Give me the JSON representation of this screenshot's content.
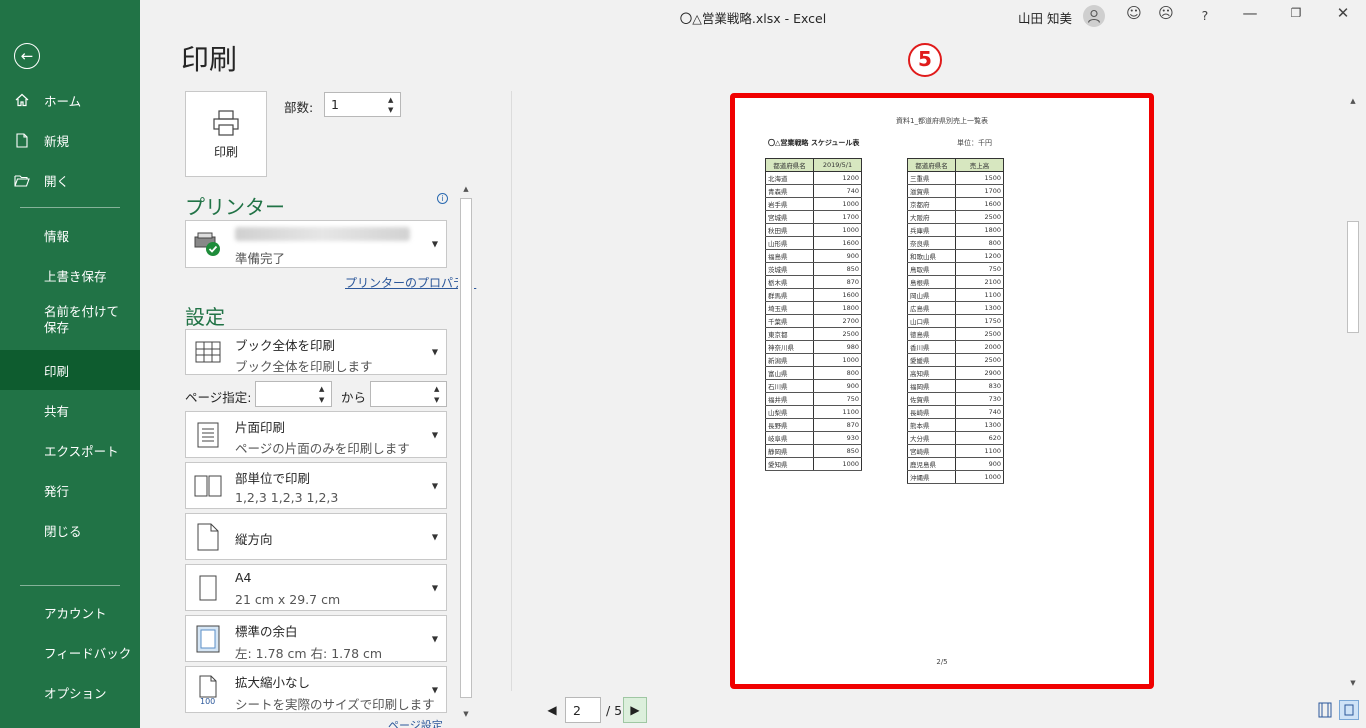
{
  "window": {
    "title": "〇△営業戦略.xlsx  -  Excel",
    "user": "山田 知美",
    "help": "?"
  },
  "sidebar": {
    "items": [
      {
        "label": "ホーム"
      },
      {
        "label": "新規"
      },
      {
        "label": "開く"
      },
      {
        "label": "情報"
      },
      {
        "label": "上書き保存"
      },
      {
        "label": "名前を付けて保存"
      },
      {
        "label": "印刷"
      },
      {
        "label": "共有"
      },
      {
        "label": "エクスポート"
      },
      {
        "label": "発行"
      },
      {
        "label": "閉じる"
      },
      {
        "label": "アカウント"
      },
      {
        "label": "フィードバック"
      },
      {
        "label": "オプション"
      }
    ],
    "active": "印刷"
  },
  "print": {
    "title": "印刷",
    "button_label": "印刷",
    "copies_label": "部数:",
    "copies_value": "1"
  },
  "printer": {
    "section_title": "プリンター",
    "status": "準備完了",
    "properties_link": "プリンターのプロパティ"
  },
  "settings": {
    "section_title": "設定",
    "what": {
      "title": "ブック全体を印刷",
      "desc": "ブック全体を印刷します"
    },
    "pages_label": "ページ指定:",
    "to_label": "から",
    "sides": {
      "title": "片面印刷",
      "desc": "ページの片面のみを印刷します"
    },
    "collate": {
      "title": "部単位で印刷",
      "desc": "1,2,3    1,2,3    1,2,3"
    },
    "orientation": {
      "title": "縦方向"
    },
    "paper": {
      "title": "A4",
      "desc": "21 cm x 29.7 cm"
    },
    "margins": {
      "title": "標準の余白",
      "desc": "左:  1.78 cm    右:  1.78 cm"
    },
    "scaling": {
      "title": "拡大縮小なし",
      "desc": "シートを実際のサイズで印刷します"
    },
    "page_setup_link": "ページ設定"
  },
  "preview": {
    "marker": "5",
    "header": "資料1_都道府県別売上一覧表",
    "doc_title": "〇△営業戦略 スケジュール表",
    "unit": "単位：千円",
    "page_label": "2/5",
    "left_table": {
      "headers": [
        "都道府県名",
        "2019/5/1"
      ],
      "rows": [
        [
          "北海道",
          "1200"
        ],
        [
          "青森県",
          "740"
        ],
        [
          "岩手県",
          "1000"
        ],
        [
          "宮城県",
          "1700"
        ],
        [
          "秋田県",
          "1000"
        ],
        [
          "山形県",
          "1600"
        ],
        [
          "福島県",
          "900"
        ],
        [
          "茨城県",
          "850"
        ],
        [
          "栃木県",
          "870"
        ],
        [
          "群馬県",
          "1600"
        ],
        [
          "埼玉県",
          "1800"
        ],
        [
          "千葉県",
          "2700"
        ],
        [
          "東京都",
          "2500"
        ],
        [
          "神奈川県",
          "980"
        ],
        [
          "新潟県",
          "1000"
        ],
        [
          "富山県",
          "800"
        ],
        [
          "石川県",
          "900"
        ],
        [
          "福井県",
          "750"
        ],
        [
          "山梨県",
          "1100"
        ],
        [
          "長野県",
          "870"
        ],
        [
          "岐阜県",
          "930"
        ],
        [
          "静岡県",
          "850"
        ],
        [
          "愛知県",
          "1000"
        ]
      ]
    },
    "right_table": {
      "headers": [
        "都道府県名",
        "売上高"
      ],
      "rows": [
        [
          "三重県",
          "1500"
        ],
        [
          "滋賀県",
          "1700"
        ],
        [
          "京都府",
          "1600"
        ],
        [
          "大阪府",
          "2500"
        ],
        [
          "兵庫県",
          "1800"
        ],
        [
          "奈良県",
          "800"
        ],
        [
          "和歌山県",
          "1200"
        ],
        [
          "鳥取県",
          "750"
        ],
        [
          "島根県",
          "2100"
        ],
        [
          "岡山県",
          "1100"
        ],
        [
          "広島県",
          "1300"
        ],
        [
          "山口県",
          "1750"
        ],
        [
          "徳島県",
          "2500"
        ],
        [
          "香川県",
          "2000"
        ],
        [
          "愛媛県",
          "2500"
        ],
        [
          "高知県",
          "2900"
        ],
        [
          "福岡県",
          "830"
        ],
        [
          "佐賀県",
          "730"
        ],
        [
          "長崎県",
          "740"
        ],
        [
          "熊本県",
          "1300"
        ],
        [
          "大分県",
          "620"
        ],
        [
          "宮崎県",
          "1100"
        ],
        [
          "鹿児島県",
          "900"
        ],
        [
          "沖縄県",
          "1000"
        ]
      ]
    }
  },
  "pager": {
    "current": "2",
    "total": "/ 5"
  }
}
